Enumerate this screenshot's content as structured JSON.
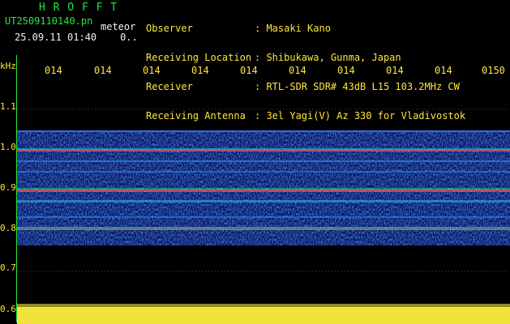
{
  "header": {
    "brand": "H R O F F T",
    "filename": "UT2509110140.pn",
    "type": "meteor",
    "timestamp": "25.09.11 01:40",
    "status": "0.."
  },
  "info": [
    {
      "key": "Observer",
      "value": ": Masaki Kano"
    },
    {
      "key": "Receiving Location",
      "value": ": Shibukawa, Gunma, Japan"
    },
    {
      "key": "Receiver",
      "value": ": RTL-SDR SDR# 43dB L15 103.2MHz CW"
    },
    {
      "key": "Receiving Antenna",
      "value": ": 3el Yagi(V) Az 330 for Vladivostok"
    }
  ],
  "time_ticks": [
    "014",
    "014",
    "014",
    "014",
    "014",
    "014",
    "014",
    "014",
    "014",
    "0150"
  ],
  "y_axis": {
    "unit": "kHz",
    "labels": [
      "1.1",
      "1.0",
      "0.9",
      "0.8",
      "0.7",
      "0.6"
    ]
  },
  "colors": {
    "text_green": "#22e83a",
    "text_white": "#f0f0f0",
    "text_yellow": "#ffe53b",
    "background": "#000000"
  }
}
